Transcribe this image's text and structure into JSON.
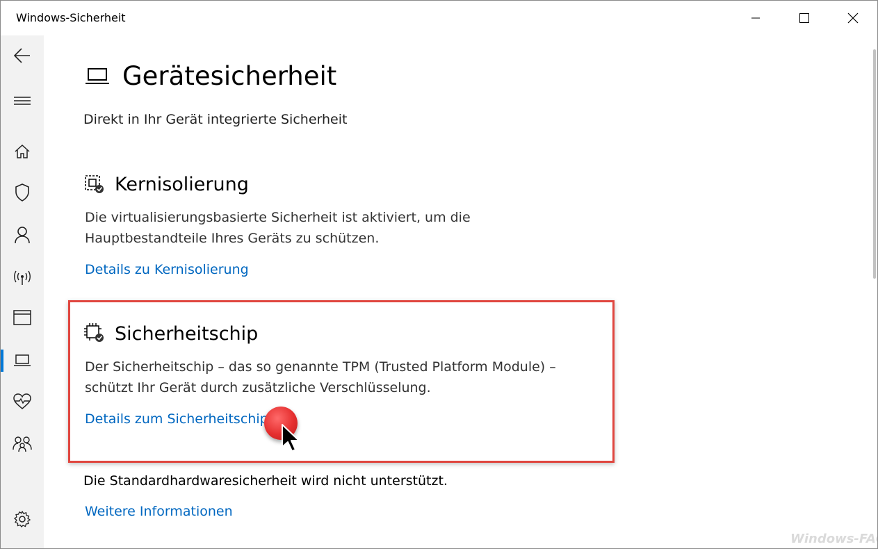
{
  "window": {
    "title": "Windows-Sicherheit"
  },
  "sidebar": {
    "items": [
      {
        "icon": "back-arrow-icon"
      },
      {
        "icon": "hamburger-menu-icon"
      },
      {
        "icon": "home-icon"
      },
      {
        "icon": "shield-icon"
      },
      {
        "icon": "person-icon"
      },
      {
        "icon": "wireless-antenna-icon"
      },
      {
        "icon": "app-browser-icon"
      },
      {
        "icon": "laptop-icon",
        "active": true
      },
      {
        "icon": "heart-pulse-icon"
      },
      {
        "icon": "family-icon"
      },
      {
        "icon": "gear-icon"
      }
    ]
  },
  "page": {
    "title": "Gerätesicherheit",
    "subtitle": "Direkt in Ihr Gerät integrierte Sicherheit"
  },
  "kernisolierung": {
    "title": "Kernisolierung",
    "desc_line1": "Die virtualisierungsbasierte Sicherheit ist aktiviert, um die",
    "desc_line2": "Hauptbestandteile Ihres Geräts zu schützen.",
    "link": "Details zu Kernisolierung"
  },
  "sicherheitschip": {
    "title": "Sicherheitschip",
    "desc_line1": "Der Sicherheitschip – das so genannte TPM (Trusted Platform Module) –",
    "desc_line2": "schützt Ihr Gerät durch zusätzliche Verschlüsselung.",
    "link": "Details zum Sicherheitschip"
  },
  "standard": {
    "text": "Die Standardhardwaresicherheit wird nicht unterstützt.",
    "link": "Weitere Informationen"
  },
  "watermark": "Windows-FAQ",
  "colors": {
    "accent": "#0078d7",
    "link": "#0067c0",
    "highlight": "#e0463f",
    "sidebar_bg": "#f2f2f2"
  }
}
